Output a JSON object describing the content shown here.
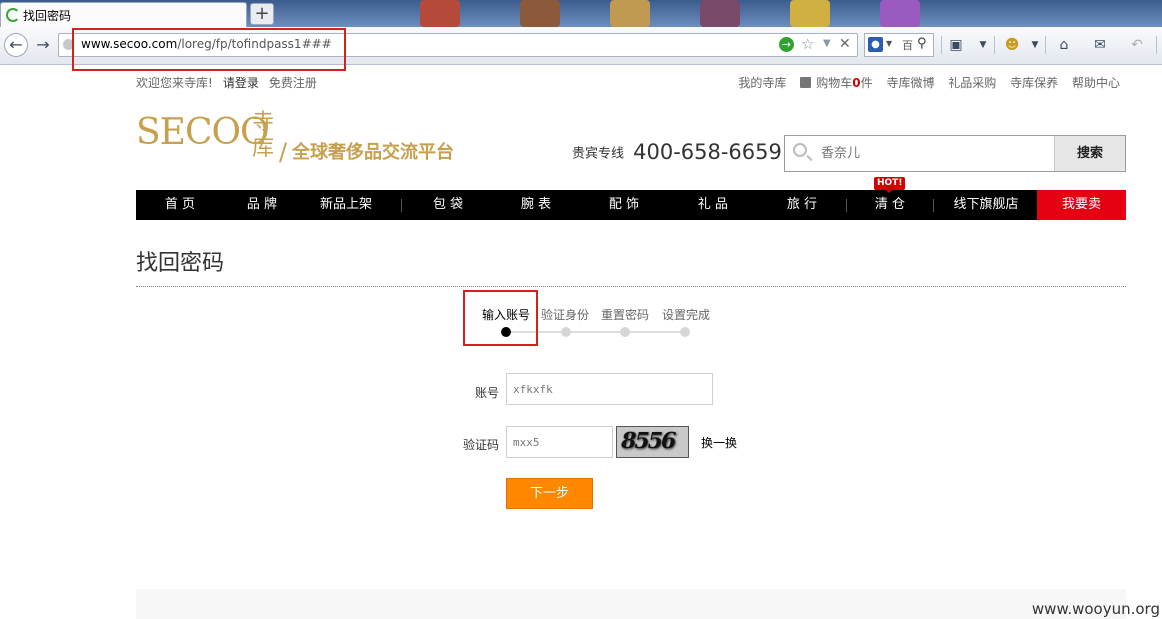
{
  "browser": {
    "tab_title": "找回密码",
    "new_tab_label": "+",
    "url_host": "www.secoo.com",
    "url_path": "/loreg/fp/tofindpass1###",
    "search_engine_text": "百"
  },
  "topbar": {
    "welcome": "欢迎您来寺库!",
    "login": "请登录",
    "register": "免费注册",
    "links": [
      "我的寺库",
      "购物车",
      "寺库微博",
      "礼品采购",
      "寺库保养",
      "帮助中心"
    ],
    "cart_count": "0",
    "cart_unit": "件"
  },
  "logo": {
    "brand": "SECOO",
    "brand_cn": "寺库",
    "slogan": "全球奢侈品交流平台"
  },
  "hotline": {
    "label": "贵宾专线",
    "number": "400-658-6659"
  },
  "site_search": {
    "placeholder": "香奈儿",
    "button": "搜索"
  },
  "nav": {
    "items": [
      "首 页",
      "品 牌",
      "新品上架",
      "包 袋",
      "腕 表",
      "配 饰",
      "礼 品",
      "旅 行",
      "清 仓",
      "线下旗舰店",
      "我要卖"
    ],
    "hot_badge": "HOT!"
  },
  "page": {
    "title": "找回密码",
    "steps": [
      "输入账号",
      "验证身份",
      "重置密码",
      "设置完成"
    ],
    "active_step": 0,
    "form": {
      "account_label": "账号",
      "account_value": "xfkxfk",
      "captcha_label": "验证码",
      "captcha_value": "mxx5",
      "captcha_image_text": "8556",
      "refresh_label": "换一换",
      "next_button": "下一步"
    }
  },
  "watermark": "www.wooyun.org",
  "colors": {
    "brand_gold": "#c7a04d",
    "nav_bg": "#000000",
    "sell_bg": "#e50012",
    "next_button": "#ff8800",
    "annotation": "#d61f1f"
  }
}
